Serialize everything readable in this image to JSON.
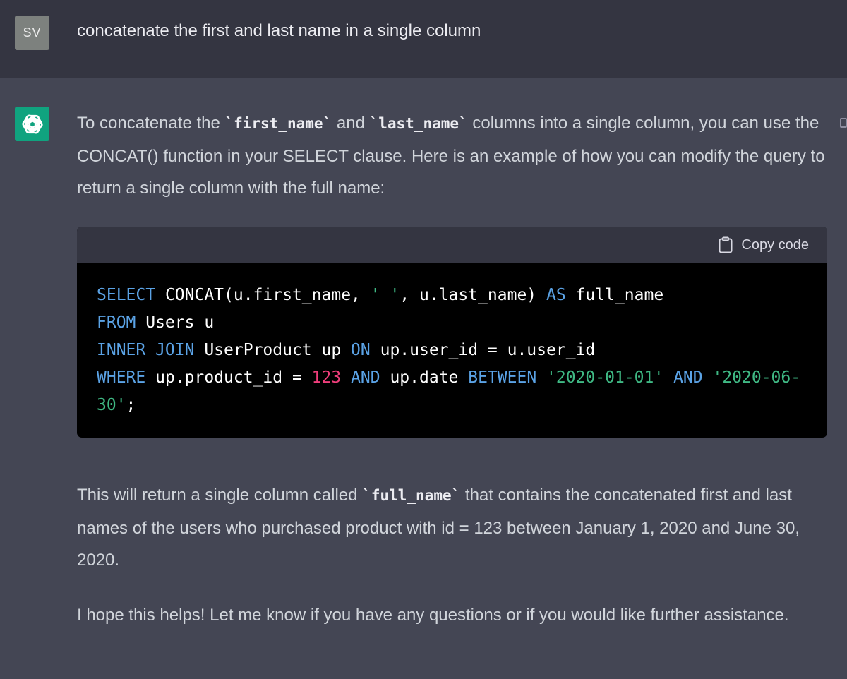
{
  "user_message": {
    "avatar_initials": "SV",
    "text": "concatenate the first and last name in a single column"
  },
  "assistant_message": {
    "intro": {
      "t1": "To concatenate the ",
      "c1": "`first_name`",
      "t2": " and ",
      "c2": "`last_name`",
      "t3": " columns into a single column, you can use the CONCAT() function in your SELECT clause. Here is an example of how you can modify the query to return a single column with the full name:"
    },
    "code_block": {
      "copy_label": "Copy code",
      "line1": {
        "a": "SELECT",
        "b": " CONCAT(u.first_name, ",
        "c": "' '",
        "d": ", u.last_name) ",
        "e": "AS",
        "f": " full_name"
      },
      "line2": {
        "a": "FROM",
        "b": " Users u"
      },
      "line3": {
        "a": "INNER JOIN",
        "b": " UserProduct up ",
        "c": "ON",
        "d": " up.user_id = u.user_id"
      },
      "line4": {
        "a": "WHERE",
        "b": " up.product_id = ",
        "c": "123",
        "d": " ",
        "e": "AND",
        "f": " up.date ",
        "g": "BETWEEN",
        "h": " ",
        "i": "'2020-01-01'",
        "j": " ",
        "k": "AND",
        "l": " ",
        "m": "'2020-06-"
      },
      "line5": {
        "a": "30'",
        "b": ";"
      }
    },
    "result": {
      "t1": "This will return a single column called ",
      "c1": "`full_name`",
      "t2": " that contains the concatenated first and last names of the users who purchased product with id = 123 between January 1, 2020 and June 30, 2020."
    },
    "closing": "I hope this helps! Let me know if you have any questions or if you would like further assistance."
  },
  "colors": {
    "page_bg": "#444654",
    "user_row_bg": "#343541",
    "gpt_avatar": "#10a37f",
    "keyword": "#5ba3e6",
    "number": "#ef3e7b",
    "string": "#3fb984"
  },
  "icons": [
    "openai-logo-icon",
    "clipboard-icon",
    "copy-message-icon"
  ]
}
